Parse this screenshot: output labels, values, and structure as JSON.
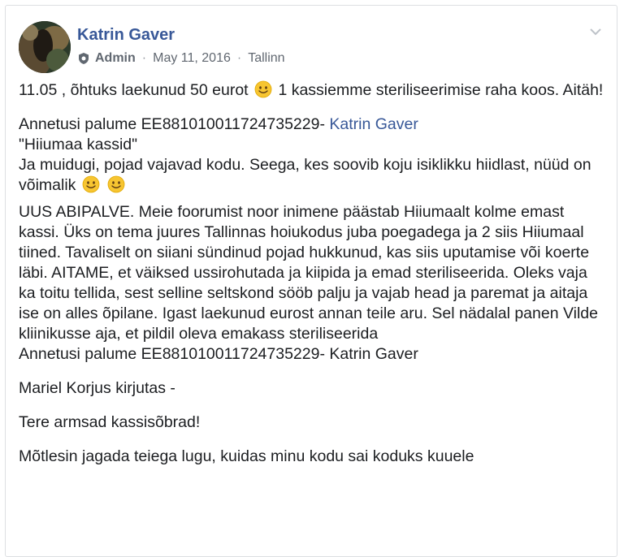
{
  "post": {
    "author": "Katrin Gaver",
    "role": "Admin",
    "date": "May 11, 2016",
    "location": "Tallinn",
    "separator": "·",
    "icons": {
      "avatar": "avatar-photo",
      "badge": "shield-icon",
      "menu": "chevron-down-icon",
      "emoji": "smiley-emoji-icon"
    },
    "colors": {
      "link": "#385898",
      "text": "#1c1e21",
      "meta": "#606770"
    }
  },
  "content": {
    "p1_a": "11.05 , õhtuks laekunud 50 eurot",
    "p1_b": " 1 kassiemme steriliseerimise raha koos. Aitäh!",
    "p2_line1_text": "Annetusi palume EE881010011724735229-",
    "p2_line1_link": "Katrin Gaver",
    "p2_line2": "\"Hiiumaa kassid\"",
    "p2_line3": "Ja muidugi, pojad vajavad kodu. Seega, kes soovib koju isiklikku hiidlast, nüüd on võimalik",
    "p3": "UUS ABIPALVE. Meie foorumist noor inimene päästab Hiiumaalt kolme emast kassi. Üks on tema juures Tallinnas hoiukodus juba poegadega ja 2 siis Hiiumaal tiined. Tavaliselt on siiani sündinud pojad hukkunud, kas siis uputamise või koerte läbi. AITAME, et väiksed ussirohutada ja kiipida ja emad steriliseerida. Oleks vaja ka toitu tellida, sest selline seltskond sööb palju ja vajab head ja paremat ja aitaja ise on alles õpilane. Igast laekunud eurost annan teile aru. Sel nädalal panen Vilde kliinikusse aja, et pildil oleva emakass steriliseerida",
    "p3_donate": "Annetusi palume EE881010011724735229- Katrin Gaver",
    "p4": "Mariel Korjus kirjutas -",
    "p5": "Tere armsad kassisõbrad!",
    "p6": "Mõtlesin jagada teiega lugu, kuidas minu kodu sai koduks kuuele"
  }
}
